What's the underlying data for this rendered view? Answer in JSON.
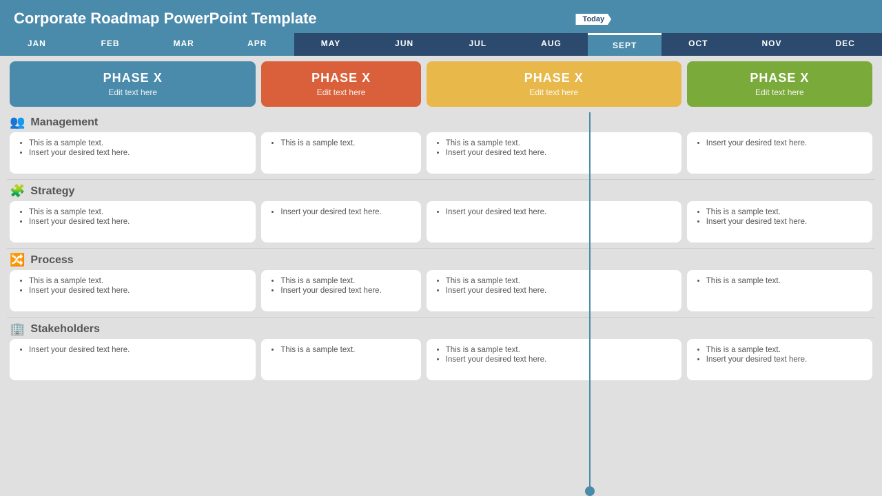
{
  "title": "Corporate Roadmap PowerPoint Template",
  "today_label": "Today",
  "months": [
    {
      "label": "JAN",
      "active": true
    },
    {
      "label": "FEB",
      "active": true
    },
    {
      "label": "MAR",
      "active": true
    },
    {
      "label": "APR",
      "active": true
    },
    {
      "label": "MAY",
      "active": false
    },
    {
      "label": "JUN",
      "active": false
    },
    {
      "label": "JUL",
      "active": false
    },
    {
      "label": "AUG",
      "active": false
    },
    {
      "label": "SEPT",
      "active": false,
      "current": true
    },
    {
      "label": "OCT",
      "active": false
    },
    {
      "label": "NOV",
      "active": false
    },
    {
      "label": "DEC",
      "active": false
    }
  ],
  "phases": [
    {
      "label": "PHASE X",
      "subtitle": "Edit text here",
      "color": "blue"
    },
    {
      "label": "PHASE X",
      "subtitle": "Edit text here",
      "color": "orange"
    },
    {
      "label": "PHASE X",
      "subtitle": "Edit text here",
      "color": "yellow"
    },
    {
      "label": "PHASE X",
      "subtitle": "Edit text here",
      "color": "green"
    }
  ],
  "sections": [
    {
      "name": "Management",
      "icon": "👥",
      "cards": [
        {
          "items": [
            "This is a sample text.",
            "Insert your desired text here."
          ]
        },
        {
          "items": [
            "This is a sample text."
          ]
        },
        {
          "items": [
            "This is a sample text.",
            "Insert your desired text here."
          ]
        },
        {
          "items": [
            "Insert your desired text here."
          ]
        }
      ]
    },
    {
      "name": "Strategy",
      "icon": "🧩",
      "cards": [
        {
          "items": [
            "This is a sample text.",
            "Insert your desired text here."
          ]
        },
        {
          "items": [
            "Insert your desired text here."
          ]
        },
        {
          "items": [
            "Insert your desired text here."
          ]
        },
        {
          "items": [
            "This is a sample text.",
            "Insert your desired text here."
          ]
        }
      ]
    },
    {
      "name": "Process",
      "icon": "🔀",
      "cards": [
        {
          "items": [
            "This is a sample text.",
            "Insert your desired text here."
          ]
        },
        {
          "items": [
            "This is a sample text.",
            "Insert your desired text here."
          ]
        },
        {
          "items": [
            "This is a sample text.",
            "Insert your desired text here."
          ]
        },
        {
          "items": [
            "This is a sample text."
          ]
        }
      ]
    },
    {
      "name": "Stakeholders",
      "icon": "🏢",
      "cards": [
        {
          "items": [
            "Insert your desired text here."
          ]
        },
        {
          "items": [
            "This is a sample text."
          ]
        },
        {
          "items": [
            "This is a sample text.",
            "Insert your desired text here."
          ]
        },
        {
          "items": [
            "This is a sample text.",
            "Insert your desired text here."
          ]
        }
      ]
    }
  ]
}
